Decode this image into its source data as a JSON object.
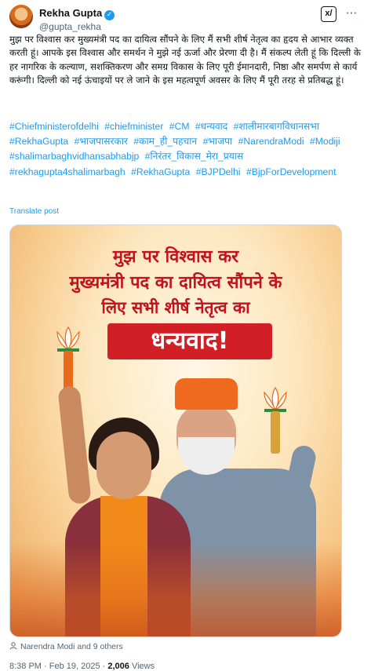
{
  "author": {
    "name": "Rekha Gupta",
    "handle": "@gupta_rekha"
  },
  "icons": {
    "verified": "verified-badge-icon",
    "grok": "grok-icon",
    "more": "more-icon",
    "lotus": "lotus-icon"
  },
  "post": {
    "text": "मुझ पर विश्वास कर मुख्यमंत्री पद का दायित्व सौंपने के लिए मैं सभी शीर्ष नेतृत्व का हृदय से आभार व्यक्त करती हूं। आपके इस विश्वास और समर्थन ने मुझे नई ऊर्जा और प्रेरणा दी है। मैं संकल्प लेती हूं कि दिल्ली के हर नागरिक के कल्याण, सशक्तिकरण और समग्र विकास के लिए पूरी ईमानदारी, निष्ठा और समर्पण से कार्य करूंगी। दिल्ली को नई ऊंचाइयों पर ले जाने के इस महत्वपूर्ण अवसर के लिए मैं पूरी तरह से प्रतिबद्ध हूं।",
    "hashtags": [
      "#Chiefministerofdelhi",
      "#chiefminister",
      "#CM",
      "#धन्यवाद",
      "#शालीमारबागविधानसभा",
      "#RekhaGupta",
      "#भाजपासरकार",
      "#काम_ही_पहचान",
      "#भाजपा",
      "#NarendraModi",
      "#Modiji",
      "#shalimarbaghvidhansabhabjp",
      "#निरंतर_विकास_मेरा_प्रयास",
      "#rekhagupta4shalimarbagh",
      "#RekhaGupta",
      "#BJPDelhi",
      "#BjpForDevelopment"
    ],
    "translate": "Translate post"
  },
  "poster": {
    "line1": "मुझ पर विश्वास कर",
    "line2": "मुख्यमंत्री पद का दायित्व सौंपने के",
    "line3": "लिए सभी शीर्ष नेतृत्व का",
    "thanks": "धन्यवाद!"
  },
  "engagement": {
    "liked_by": "Narendra Modi and 9 others"
  },
  "meta": {
    "time": "8:38 PM",
    "date": "Feb 19, 2025",
    "views_count": "2,006",
    "views_label": "Views"
  }
}
